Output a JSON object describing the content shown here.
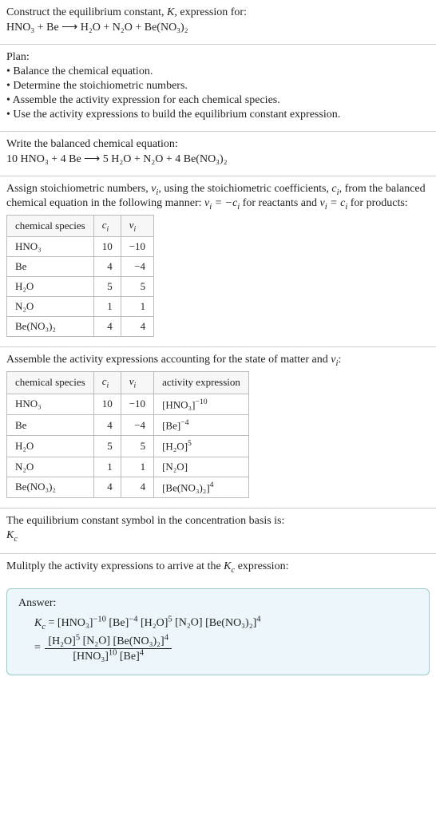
{
  "intro": {
    "line1_a": "Construct the equilibrium constant, ",
    "line1_b": ", expression for:",
    "equation_lhs": "HNO₃ + Be",
    "equation_rhs": "H₂O + N₂O + Be(NO₃)₂"
  },
  "plan": {
    "heading": "Plan:",
    "bullets": [
      "• Balance the chemical equation.",
      "• Determine the stoichiometric numbers.",
      "• Assemble the activity expression for each chemical species.",
      "• Use the activity expressions to build the equilibrium constant expression."
    ]
  },
  "balance": {
    "heading": "Write the balanced chemical equation:",
    "lhs": "10 HNO₃ + 4 Be",
    "rhs": "5 H₂O + N₂O + 4 Be(NO₃)₂"
  },
  "assign": {
    "text_a": "Assign stoichiometric numbers, ",
    "text_b": ", using the stoichiometric coefficients, ",
    "text_c": ", from the balanced chemical equation in the following manner: ",
    "text_d": " for reactants and ",
    "text_e": " for products:"
  },
  "table1": {
    "headers": [
      "chemical species",
      "cᵢ",
      "νᵢ"
    ],
    "rows": [
      [
        "HNO₃",
        "10",
        "−10"
      ],
      [
        "Be",
        "4",
        "−4"
      ],
      [
        "H₂O",
        "5",
        "5"
      ],
      [
        "N₂O",
        "1",
        "1"
      ],
      [
        "Be(NO₃)₂",
        "4",
        "4"
      ]
    ]
  },
  "assemble": {
    "text_a": "Assemble the activity expressions accounting for the state of matter and ",
    "text_b": ":"
  },
  "table2": {
    "headers": [
      "chemical species",
      "cᵢ",
      "νᵢ",
      "activity expression"
    ],
    "rows": [
      {
        "sp": "HNO₃",
        "c": "10",
        "v": "−10",
        "act_base": "[HNO₃]",
        "act_exp": "−10"
      },
      {
        "sp": "Be",
        "c": "4",
        "v": "−4",
        "act_base": "[Be]",
        "act_exp": "−4"
      },
      {
        "sp": "H₂O",
        "c": "5",
        "v": "5",
        "act_base": "[H₂O]",
        "act_exp": "5"
      },
      {
        "sp": "N₂O",
        "c": "1",
        "v": "1",
        "act_base": "[N₂O]",
        "act_exp": ""
      },
      {
        "sp": "Be(NO₃)₂",
        "c": "4",
        "v": "4",
        "act_base": "[Be(NO₃)₂]",
        "act_exp": "4"
      }
    ]
  },
  "eqsym": {
    "line": "The equilibrium constant symbol in the concentration basis is:"
  },
  "multiply": {
    "line_a": "Mulitply the activity expressions to arrive at the ",
    "line_b": " expression:"
  },
  "answer": {
    "label": "Answer:",
    "flat": {
      "t1_base": "[HNO₃]",
      "t1_exp": "−10",
      "t2_base": "[Be]",
      "t2_exp": "−4",
      "t3_base": "[H₂O]",
      "t3_exp": "5",
      "t4_base": "[N₂O]",
      "t5_base": "[Be(NO₃)₂]",
      "t5_exp": "4"
    },
    "frac": {
      "num": {
        "t1_base": "[H₂O]",
        "t1_exp": "5",
        "t2_base": "[N₂O]",
        "t3_base": "[Be(NO₃)₂]",
        "t3_exp": "4"
      },
      "den": {
        "t1_base": "[HNO₃]",
        "t1_exp": "10",
        "t2_base": "[Be]",
        "t2_exp": "4"
      }
    }
  },
  "chart_data": {
    "type": "table",
    "tables": [
      {
        "title": "Stoichiometric numbers",
        "headers": [
          "chemical species",
          "c_i",
          "nu_i"
        ],
        "rows": [
          [
            "HNO3",
            10,
            -10
          ],
          [
            "Be",
            4,
            -4
          ],
          [
            "H2O",
            5,
            5
          ],
          [
            "N2O",
            1,
            1
          ],
          [
            "Be(NO3)2",
            4,
            4
          ]
        ]
      },
      {
        "title": "Activity expressions",
        "headers": [
          "chemical species",
          "c_i",
          "nu_i",
          "activity expression"
        ],
        "rows": [
          [
            "HNO3",
            10,
            -10,
            "[HNO3]^(-10)"
          ],
          [
            "Be",
            4,
            -4,
            "[Be]^(-4)"
          ],
          [
            "H2O",
            5,
            5,
            "[H2O]^5"
          ],
          [
            "N2O",
            1,
            1,
            "[N2O]"
          ],
          [
            "Be(NO3)2",
            4,
            4,
            "[Be(NO3)2]^4"
          ]
        ]
      }
    ]
  }
}
